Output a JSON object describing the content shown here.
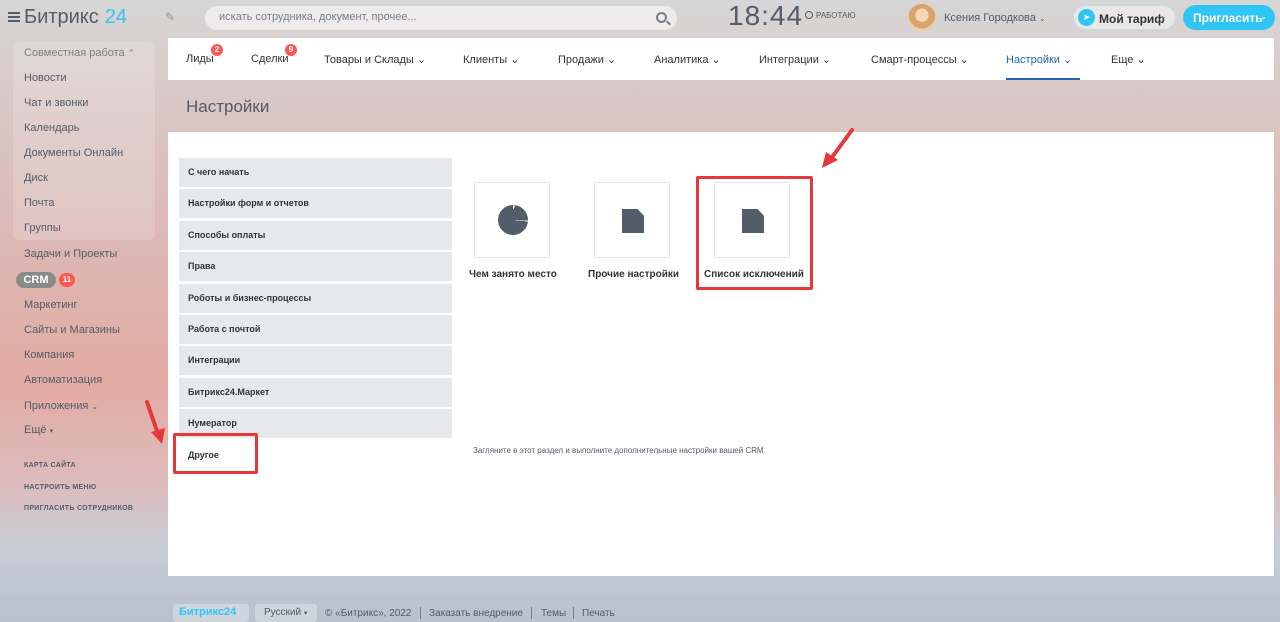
{
  "header": {
    "logo_text": "Битрикс",
    "logo_num": "24",
    "search_placeholder": "искать сотрудника, документ, прочее...",
    "clock": "18:44",
    "work_status": "РАБОТАЮ",
    "user_name": "Ксения Городкова",
    "tariff_label": "Мой тариф",
    "invite_label": "Пригласить"
  },
  "sidebar": {
    "group_label": "Совместная работа",
    "items": [
      "Новости",
      "Чат и звонки",
      "Календарь",
      "Документы Онлайн",
      "Диск",
      "Почта",
      "Группы",
      "Задачи и Проекты",
      "CRM",
      "Маркетинг",
      "Сайты и Магазины",
      "Компания",
      "Автоматизация",
      "Приложения",
      "Ещё"
    ],
    "crm_badge": "11",
    "small_links": [
      "КАРТА САЙТА",
      "НАСТРОИТЬ МЕНЮ",
      "ПРИГЛАСИТЬ СОТРУДНИКОВ"
    ]
  },
  "tabs": {
    "items": [
      "Лиды",
      "Сделки",
      "Товары и Склады",
      "Клиенты",
      "Продажи",
      "Аналитика",
      "Интеграции",
      "Смарт-процессы",
      "Настройки",
      "Еще"
    ],
    "badges": {
      "leads": "2",
      "deals": "9"
    },
    "active": "Настройки"
  },
  "page": {
    "title": "Настройки"
  },
  "settings_menu": {
    "items": [
      "С чего начать",
      "Настройки форм и отчетов",
      "Способы оплаты",
      "Права",
      "Роботы и бизнес-процессы",
      "Работа с почтой",
      "Интеграции",
      "Битрикс24.Маркет",
      "Нумератор",
      "Другое"
    ],
    "active": "Другое"
  },
  "tiles": [
    {
      "label": "Чем занято место",
      "icon": "pie-chart-icon"
    },
    {
      "label": "Прочие настройки",
      "icon": "file-icon"
    },
    {
      "label": "Список исключений",
      "icon": "file-icon"
    }
  ],
  "hint_text": "Загляните в этот раздел и выполните дополнительные настройки вашей CRM.",
  "footer": {
    "logo": "Битрикс24",
    "language": "Русский",
    "copyright": "© «Битрикс», 2022",
    "links": [
      "Заказать внедрение",
      "Темы",
      "Печать"
    ]
  },
  "colors": {
    "accent": "#2fc6f6",
    "active_tab": "#2067b0",
    "badge": "#ff5752",
    "highlight": "#e5383b"
  }
}
